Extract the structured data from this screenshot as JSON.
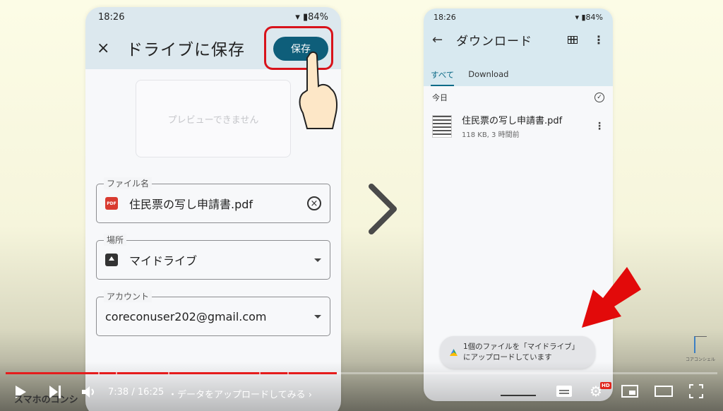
{
  "left_phone": {
    "status": {
      "time": "18:26",
      "battery": "84%"
    },
    "header": {
      "close_icon": "×",
      "title": "ドライブに保存",
      "save_label": "保存"
    },
    "preview_text": "プレビューできません",
    "fields": {
      "filename": {
        "label": "ファイル名",
        "value": "住民票の写し申請書.pdf",
        "icon": "PDF"
      },
      "location": {
        "label": "場所",
        "value": "マイドライブ"
      },
      "account": {
        "label": "アカウント",
        "value": "coreconuser202@gmail.com"
      }
    }
  },
  "right_phone": {
    "status": {
      "time": "18:26",
      "battery": "84%"
    },
    "header": {
      "back_icon": "←",
      "title": "ダウンロード",
      "more_icon": "⋮"
    },
    "tabs": [
      {
        "label": "すべて",
        "active": true
      },
      {
        "label": "Download",
        "active": false
      }
    ],
    "section_label": "今日",
    "file": {
      "name": "住民票の写し申請書.pdf",
      "meta": "118 KB, 3 時間前"
    },
    "toast": {
      "line1": "1個のファイルを「マイドライブ」",
      "line2": "にアップロードしています"
    }
  },
  "logo_text": "コアコンシェル",
  "player": {
    "time_display": "7:38 / 16:25",
    "chapter_title": "・データをアップロードしてみる ›",
    "progress_fraction": 0.465,
    "chapter_markers": [
      0.13,
      0.155,
      0.228,
      0.356,
      0.396
    ],
    "watermark": "スマホのコンシ",
    "hd_badge": "HD",
    "accent_color": "#e51c1c"
  }
}
